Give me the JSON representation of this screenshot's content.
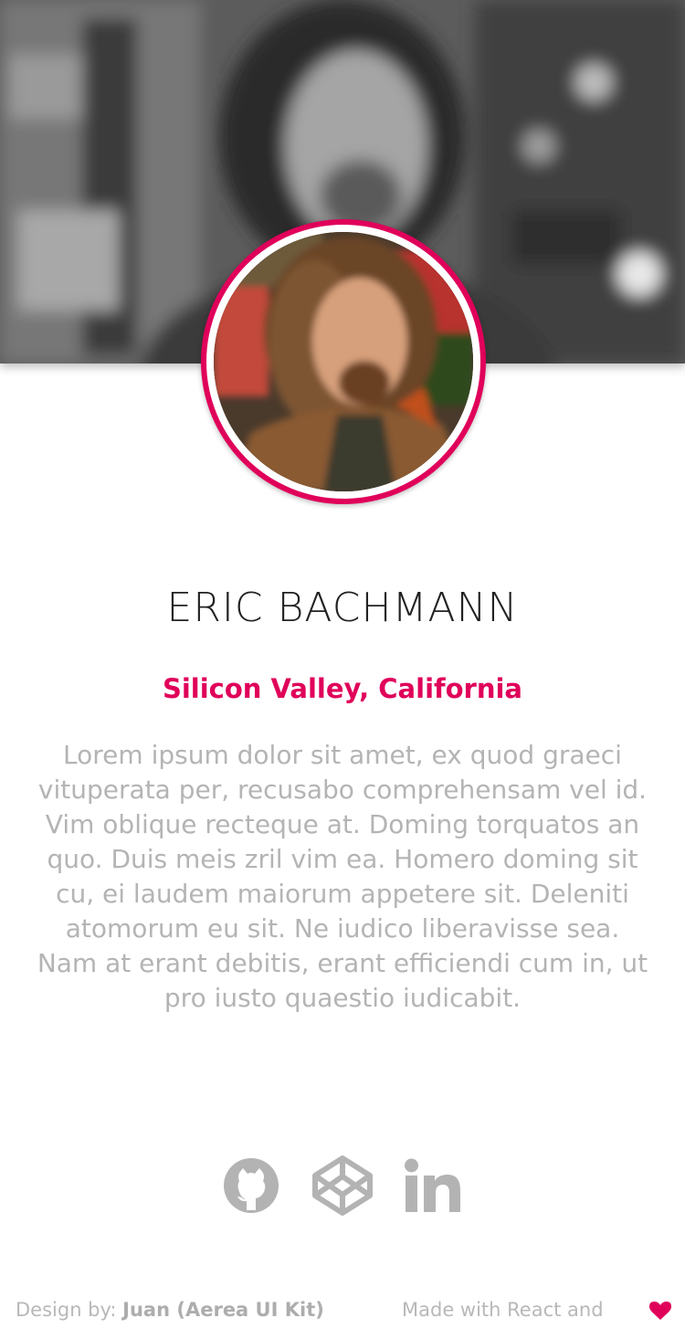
{
  "profile": {
    "name": "ERIC BACHMANN",
    "location": "Silicon Valley, California",
    "bio": "Lorem ipsum dolor sit amet, ex quod graeci vituperata per, recusabo comprehensam vel id. Vim oblique recteque at. Doming torquatos an quo. Duis meis zril vim ea. Homero doming sit cu, ei laudem maiorum appetere sit. Deleniti atomorum eu sit. Ne iudico liberavisse sea. Nam at erant debitis, erant efficiendi cum in, ut pro iusto quaestio iudicabit."
  },
  "social": [
    {
      "name": "github",
      "icon": "github-icon"
    },
    {
      "name": "codepen",
      "icon": "codepen-icon"
    },
    {
      "name": "linkedin",
      "icon": "linkedin-icon"
    }
  ],
  "footer": {
    "credit_prefix": "Design by: ",
    "credit_author": "Juan (Aerea UI Kit)",
    "made_with": "Made with React and",
    "heart_icon": "heart-icon"
  },
  "colors": {
    "accent": "#e0005a",
    "name_text": "#222222",
    "muted_text": "#b4b4b4",
    "icon_gray": "#b3b3b3"
  }
}
